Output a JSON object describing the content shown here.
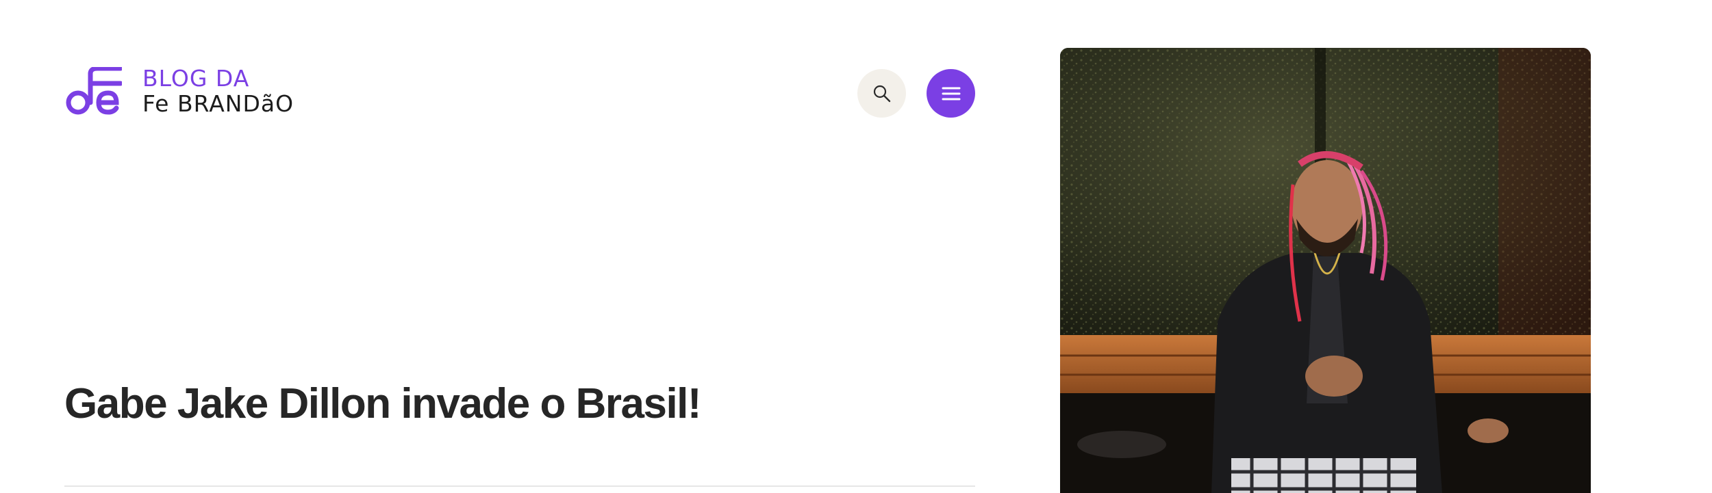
{
  "header": {
    "logo": {
      "line1": "BLOG DA",
      "line2": "Fe BRANDãO",
      "mark_icon": "music-note-fe-logo-icon"
    },
    "search_button": {
      "icon": "search-icon"
    },
    "menu_button": {
      "icon": "hamburger-menu-icon"
    }
  },
  "post": {
    "title": "Gabe Jake Dillon invade o Brasil!"
  },
  "colors": {
    "brand_purple": "#7b3fe4",
    "search_button_bg": "#f3f0ea",
    "title_text": "#262626",
    "logo_text_dark": "#1c1c1c"
  }
}
